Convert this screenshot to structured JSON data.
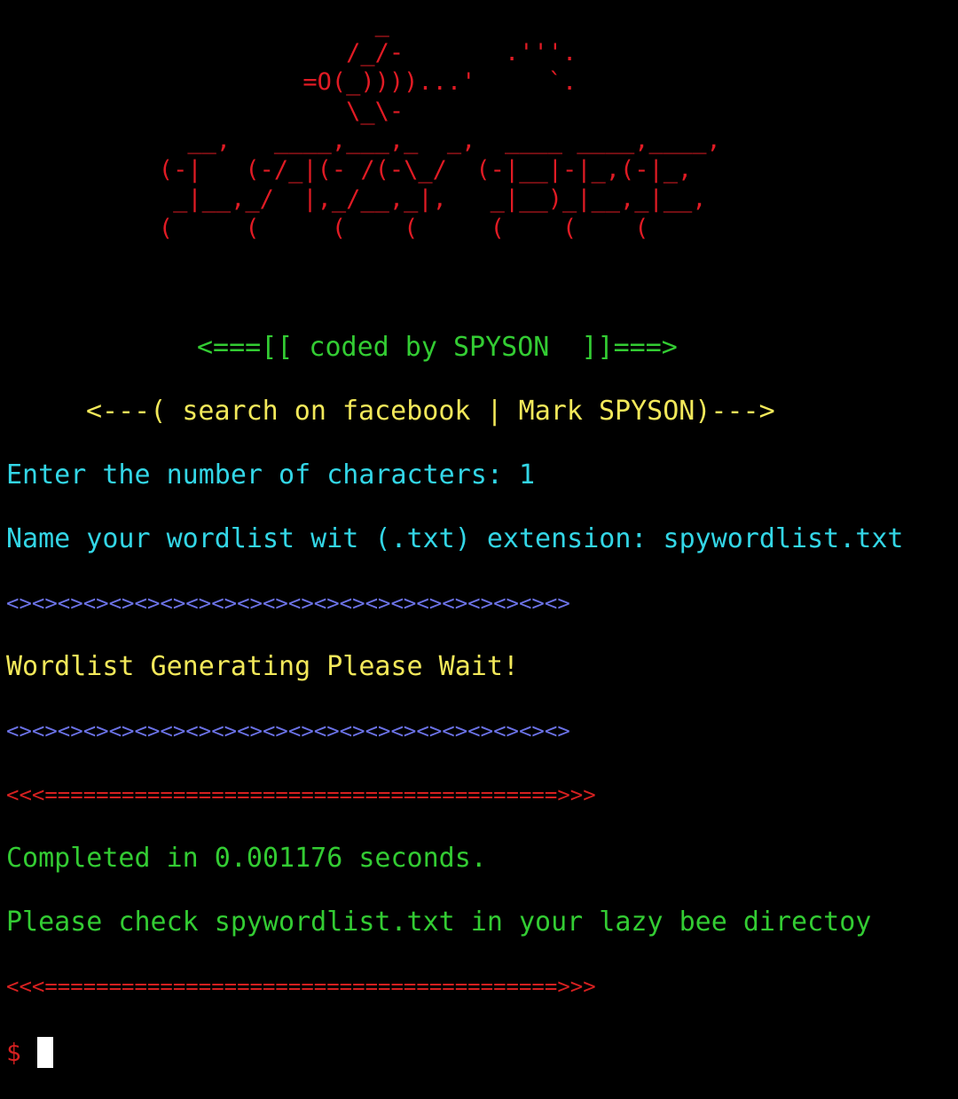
{
  "banner": {
    "art": "                          _\n                        /_/-       .'''.\n                     =O(_))))...'     `.\n                        \\_\\-\n             __,   ____,___,_  _,  ____ ____,____,\n           (-|   (-/_|(- /(-\\_/  (-|__|-|_,(-|_,\n            _|__,_/  |,_/__,_|,   _|__)_|__,_|__,\n           (     (     (    (     (    (    ("
  },
  "header": {
    "coded_by": "<===[[ coded by SPYSON  ]]===>",
    "search_hint": "<---( search on facebook | Mark SPYSON)--->"
  },
  "session": {
    "prompt_chars": "Enter the number of characters: 1",
    "prompt_name": "Name your wordlist wit (.txt) extension: spywordlist.txt",
    "separator_blue_1": "<><><><><><><><><><><><><><><><><><><><><><>",
    "generating": "Wordlist Generating Please Wait!",
    "separator_blue_2": "<><><><><><><><><><><><><><><><><><><><><><>",
    "separator_red_1": "<<<========================================>>>",
    "completed": "Completed in 0.001176 seconds.",
    "check_file": "Please check spywordlist.txt in your lazy bee directoy",
    "separator_red_2": "<<<========================================>>>"
  },
  "prompt": {
    "symbol": "$"
  },
  "colors": {
    "background": "#000000",
    "art": "#e01b24",
    "green": "#33cc33",
    "yellow": "#f2e85a",
    "cyan": "#33d6e6",
    "blue": "#6b72e6",
    "red": "#d62020",
    "cursor": "#ffffff"
  }
}
